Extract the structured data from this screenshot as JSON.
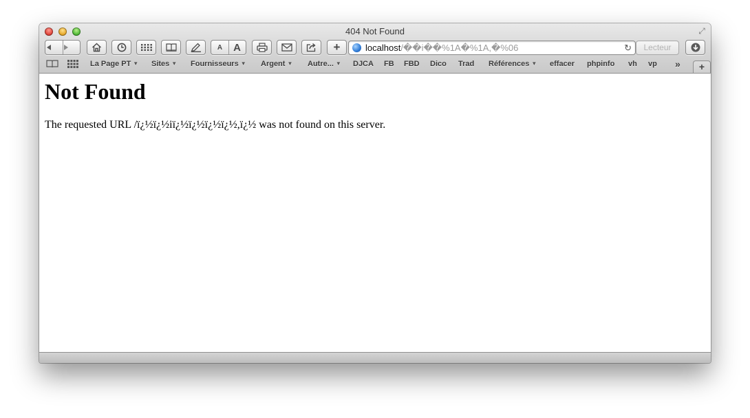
{
  "window": {
    "title": "404 Not Found"
  },
  "toolbar": {
    "add_label": "+",
    "reader_label": "Lecteur"
  },
  "address": {
    "host": "localhost",
    "path": "/��i��%1A�%1A,�%06"
  },
  "bookmarks": [
    {
      "label": "La Page PT",
      "menu": true
    },
    {
      "label": "Sites",
      "menu": true
    },
    {
      "label": "Fournisseurs",
      "menu": true
    },
    {
      "label": "Argent",
      "menu": true
    },
    {
      "label": "Autre...",
      "menu": true
    },
    {
      "label": "DJCA",
      "menu": false
    },
    {
      "label": "FB",
      "menu": false
    },
    {
      "label": "FBD",
      "menu": false
    },
    {
      "label": "Dico",
      "menu": false
    },
    {
      "label": "Trad",
      "menu": false
    },
    {
      "label": "Références",
      "menu": true
    },
    {
      "label": "effacer",
      "menu": false
    },
    {
      "label": "phpinfo",
      "menu": false
    },
    {
      "label": "vh",
      "menu": false
    },
    {
      "label": "vp",
      "menu": false
    }
  ],
  "page": {
    "heading": "Not Found",
    "message": "The requested URL /ï¿½ï¿½iï¿½ï¿½ï¿½ï¿½,ï¿½ was not found on this server."
  }
}
